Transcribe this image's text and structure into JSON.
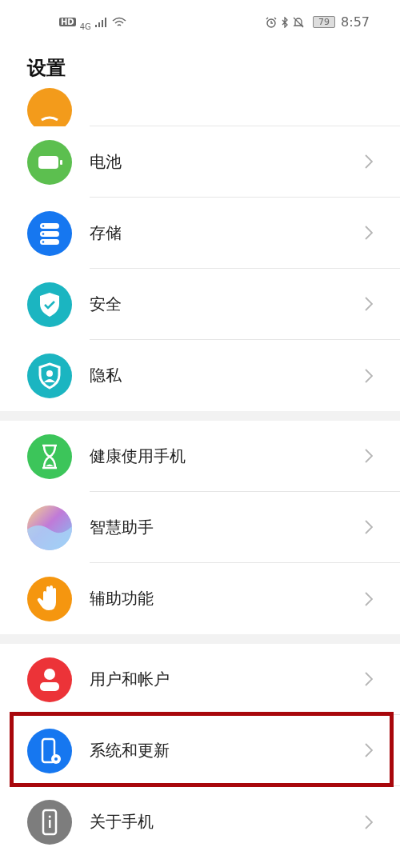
{
  "status_bar": {
    "hd": "HD",
    "network": "4G",
    "battery": "79",
    "time": "8:57"
  },
  "title": "设置",
  "groups": [
    {
      "items": [
        {
          "kind": "partial",
          "highlighted": false
        },
        {
          "kind": "battery",
          "label": "电池",
          "highlighted": false
        },
        {
          "kind": "storage",
          "label": "存储",
          "highlighted": false
        },
        {
          "kind": "security",
          "label": "安全",
          "highlighted": false
        },
        {
          "kind": "privacy",
          "label": "隐私",
          "highlighted": false
        }
      ]
    },
    {
      "items": [
        {
          "kind": "hourglass",
          "label": "健康使用手机",
          "highlighted": false
        },
        {
          "kind": "assistant",
          "label": "智慧助手",
          "highlighted": false
        },
        {
          "kind": "accessibility",
          "label": "辅助功能",
          "highlighted": false
        }
      ]
    },
    {
      "items": [
        {
          "kind": "user",
          "label": "用户和帐户",
          "highlighted": false
        },
        {
          "kind": "system",
          "label": "系统和更新",
          "highlighted": true
        },
        {
          "kind": "about",
          "label": "关于手机",
          "highlighted": false
        }
      ]
    }
  ]
}
